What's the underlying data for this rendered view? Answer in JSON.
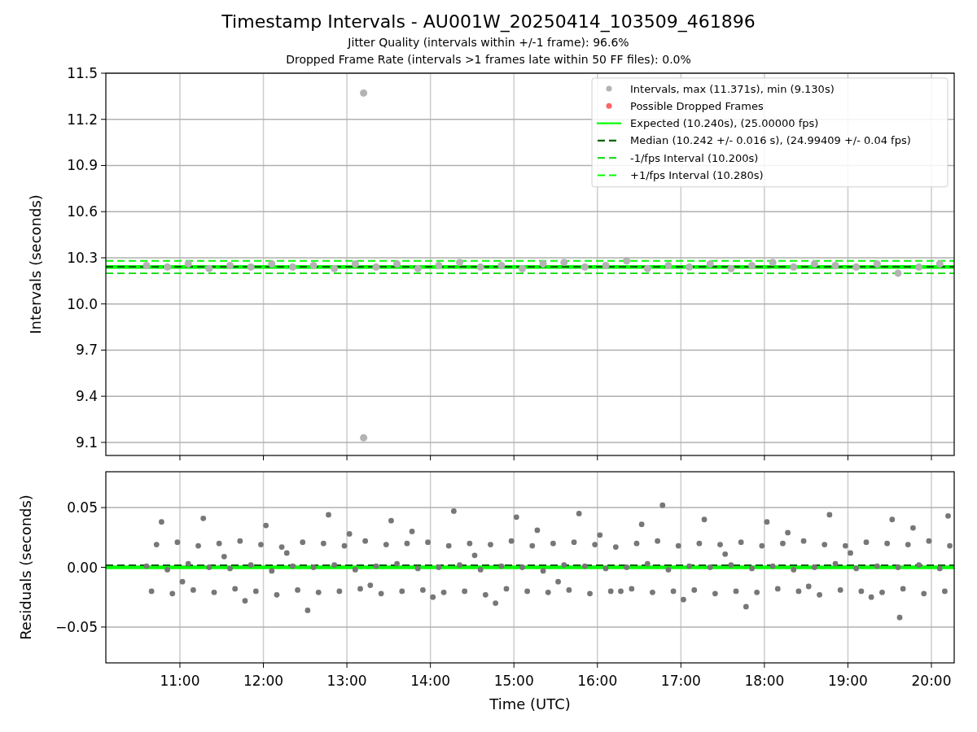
{
  "figure": {
    "title": "Timestamp Intervals - AU001W_20250414_103509_461896",
    "subtitles": [
      "Jitter Quality (intervals within +/-1 frame): 96.6%",
      "Dropped Frame Rate (intervals >1 frames late within 50 FF files): 0.0%"
    ]
  },
  "intervals_plot": {
    "chart_data": {
      "type": "scatter",
      "grid": true,
      "legend": "upper right",
      "ylabel": "Intervals (seconds)",
      "xlim": [
        10.113,
        20.273
      ],
      "ylim": [
        9.015,
        11.5
      ],
      "yticks": [
        {
          "value": 9.1,
          "label": "9.1"
        },
        {
          "value": 9.4,
          "label": "9.4"
        },
        {
          "value": 9.7,
          "label": "9.7"
        },
        {
          "value": 10.0,
          "label": "10.0"
        },
        {
          "value": 10.3,
          "label": "10.3"
        },
        {
          "value": 10.6,
          "label": "10.6"
        },
        {
          "value": 10.9,
          "label": "10.9"
        },
        {
          "value": 11.2,
          "label": "11.2"
        },
        {
          "value": 11.5,
          "label": "11.5"
        }
      ],
      "series": [
        {
          "name": "Intervals, max (11.371s), min (9.130s)",
          "type": "scatter",
          "color": "#b3b3b3",
          "x": [
            10.6,
            10.85,
            11.1,
            11.35,
            11.6,
            11.85,
            12.1,
            12.35,
            12.6,
            12.85,
            13.1,
            13.2,
            13.2,
            13.35,
            13.6,
            13.85,
            14.1,
            14.35,
            14.6,
            14.85,
            15.1,
            15.35,
            15.6,
            15.85,
            16.1,
            16.35,
            16.6,
            16.85,
            17.1,
            17.35,
            17.6,
            17.85,
            18.1,
            18.35,
            18.6,
            18.85,
            19.1,
            19.35,
            19.6,
            19.85,
            20.1
          ],
          "values": [
            10.25,
            10.24,
            10.26,
            10.23,
            10.25,
            10.24,
            10.26,
            10.24,
            10.25,
            10.23,
            10.26,
            11.371,
            9.13,
            10.24,
            10.26,
            10.23,
            10.25,
            10.27,
            10.24,
            10.25,
            10.23,
            10.26,
            10.27,
            10.24,
            10.25,
            10.28,
            10.23,
            10.25,
            10.24,
            10.26,
            10.23,
            10.25,
            10.27,
            10.24,
            10.26,
            10.25,
            10.24,
            10.26,
            10.2,
            10.24,
            10.26
          ]
        },
        {
          "name": "Possible Dropped Frames",
          "type": "scatter",
          "color": "#ff6666"
        },
        {
          "name": "Expected (10.240s), (25.00000 fps)",
          "type": "line",
          "line_style": "solid",
          "color": "#00ff00",
          "x": [
            10.113,
            20.273
          ],
          "values": [
            10.24,
            10.24
          ]
        },
        {
          "name": "Median (10.242 +/- 0.016 s), (24.99409 +/- 0.04 fps)",
          "type": "line",
          "line_style": "dashed",
          "color": "#006400",
          "x": [
            10.113,
            20.273
          ],
          "values": [
            10.242,
            10.242
          ]
        },
        {
          "name": "-1/fps Interval (10.200s)",
          "type": "line",
          "line_style": "dashed",
          "color": "#22dd22",
          "x": [
            10.113,
            20.273
          ],
          "values": [
            10.2,
            10.2
          ]
        },
        {
          "name": "+1/fps Interval (10.280s)",
          "type": "line",
          "line_style": "dashed",
          "color": "#00ff00",
          "x": [
            10.113,
            20.273
          ],
          "values": [
            10.28,
            10.28
          ]
        }
      ]
    }
  },
  "residuals_plot": {
    "chart_data": {
      "type": "scatter",
      "grid": true,
      "xlabel": "Time (UTC)",
      "ylabel": "Residuals (seconds)",
      "xlim": [
        10.113,
        20.273
      ],
      "ylim": [
        -0.08,
        0.08
      ],
      "xticks": [
        {
          "value": 11,
          "label": "11:00"
        },
        {
          "value": 12,
          "label": "12:00"
        },
        {
          "value": 13,
          "label": "13:00"
        },
        {
          "value": 14,
          "label": "14:00"
        },
        {
          "value": 15,
          "label": "15:00"
        },
        {
          "value": 16,
          "label": "16:00"
        },
        {
          "value": 17,
          "label": "17:00"
        },
        {
          "value": 18,
          "label": "18:00"
        },
        {
          "value": 19,
          "label": "19:00"
        },
        {
          "value": 20,
          "label": "20:00"
        }
      ],
      "yticks": [
        {
          "value": -0.05,
          "label": "−0.05"
        },
        {
          "value": 0,
          "label": "0.00"
        },
        {
          "value": 0.05,
          "label": "0.05"
        }
      ],
      "series": [
        {
          "type": "scatter",
          "color": "#777777",
          "x": [
            10.72,
            10.97,
            11.22,
            11.47,
            11.72,
            11.97,
            12.22,
            12.47,
            12.72,
            12.97,
            13.22,
            13.47,
            13.72,
            13.97,
            14.22,
            14.47,
            14.72,
            14.97,
            15.22,
            15.47,
            15.72,
            15.97,
            16.22,
            16.47,
            16.72,
            16.97,
            17.22,
            17.47,
            17.72,
            17.97,
            18.22,
            18.47,
            18.72,
            18.97,
            19.22,
            19.47,
            19.72,
            19.97,
            20.22,
            10.6,
            10.85,
            11.1,
            11.35,
            11.6,
            11.85,
            12.1,
            12.35,
            12.6,
            12.85,
            13.1,
            13.35,
            13.6,
            13.85,
            14.1,
            14.35,
            14.6,
            14.85,
            15.1,
            15.35,
            15.6,
            15.85,
            16.1,
            16.35,
            16.6,
            16.85,
            17.1,
            17.35,
            17.6,
            17.85,
            18.1,
            18.35,
            18.6,
            18.85,
            19.1,
            19.35,
            19.6,
            19.85,
            20.1,
            10.66,
            10.91,
            11.16,
            11.41,
            11.66,
            11.91,
            12.16,
            12.41,
            12.66,
            12.91,
            13.16,
            13.41,
            13.66,
            13.91,
            14.16,
            14.41,
            14.66,
            14.91,
            15.16,
            15.41,
            15.66,
            15.91,
            16.16,
            16.41,
            16.66,
            16.91,
            17.16,
            17.41,
            17.66,
            17.91,
            18.16,
            18.41,
            18.66,
            18.91,
            19.16,
            19.41,
            19.66,
            19.91,
            20.16,
            10.78,
            11.03,
            11.28,
            11.53,
            11.78,
            12.03,
            12.28,
            12.53,
            12.78,
            13.03,
            13.28,
            13.53,
            13.78,
            14.03,
            14.28,
            14.53,
            14.78,
            15.03,
            15.28,
            15.53,
            15.78,
            16.03,
            16.28,
            16.53,
            16.78,
            17.03,
            17.28,
            17.53,
            17.78,
            18.03,
            18.28,
            18.53,
            18.78,
            19.03,
            19.28,
            19.53,
            19.62,
            19.78,
            20.2
          ],
          "values": [
            0.019,
            0.021,
            0.018,
            0.02,
            0.022,
            0.019,
            0.017,
            0.021,
            0.02,
            0.018,
            0.022,
            0.019,
            0.02,
            0.021,
            0.018,
            0.02,
            0.019,
            0.022,
            0.018,
            0.02,
            0.021,
            0.019,
            0.017,
            0.02,
            0.022,
            0.018,
            0.02,
            0.019,
            0.021,
            0.018,
            0.02,
            0.022,
            0.019,
            0.018,
            0.021,
            0.02,
            0.019,
            0.022,
            0.018,
            0.001,
            -0.002,
            0.003,
            0,
            -0.001,
            0.002,
            -0.003,
            0.001,
            0,
            0.002,
            -0.002,
            0.001,
            0.003,
            -0.001,
            0,
            0.002,
            -0.002,
            0.001,
            0,
            -0.003,
            0.002,
            0.001,
            -0.001,
            0,
            0.003,
            -0.002,
            0.001,
            0,
            0.002,
            -0.001,
            0.001,
            -0.002,
            0,
            0.003,
            -0.001,
            0.001,
            0,
            0.002,
            -0.001,
            -0.02,
            -0.022,
            -0.019,
            -0.021,
            -0.018,
            -0.02,
            -0.023,
            -0.019,
            -0.021,
            -0.02,
            -0.018,
            -0.022,
            -0.02,
            -0.019,
            -0.021,
            -0.02,
            -0.023,
            -0.018,
            -0.02,
            -0.021,
            -0.019,
            -0.022,
            -0.02,
            -0.018,
            -0.021,
            -0.02,
            -0.019,
            -0.022,
            -0.02,
            -0.021,
            -0.018,
            -0.02,
            -0.023,
            -0.019,
            -0.02,
            -0.021,
            -0.018,
            -0.022,
            -0.02,
            0.038,
            -0.012,
            0.041,
            0.009,
            -0.028,
            0.035,
            0.012,
            -0.036,
            0.044,
            0.028,
            -0.015,
            0.039,
            0.03,
            -0.025,
            0.047,
            0.01,
            -0.03,
            0.042,
            0.031,
            -0.012,
            0.045,
            0.027,
            -0.02,
            0.036,
            0.052,
            -0.027,
            0.04,
            0.011,
            -0.033,
            0.038,
            0.029,
            -0.016,
            0.044,
            0.012,
            -0.025,
            0.04,
            -0.042,
            0.033,
            0.043
          ]
        },
        {
          "type": "line",
          "line_style": "solid",
          "color": "#00ff00",
          "x": [
            10.113,
            20.273
          ],
          "values": [
            0,
            0
          ]
        },
        {
          "type": "line",
          "line_style": "dashed",
          "color": "#006400",
          "x": [
            10.113,
            20.273
          ],
          "values": [
            0.0017,
            0.0017
          ]
        }
      ]
    }
  }
}
